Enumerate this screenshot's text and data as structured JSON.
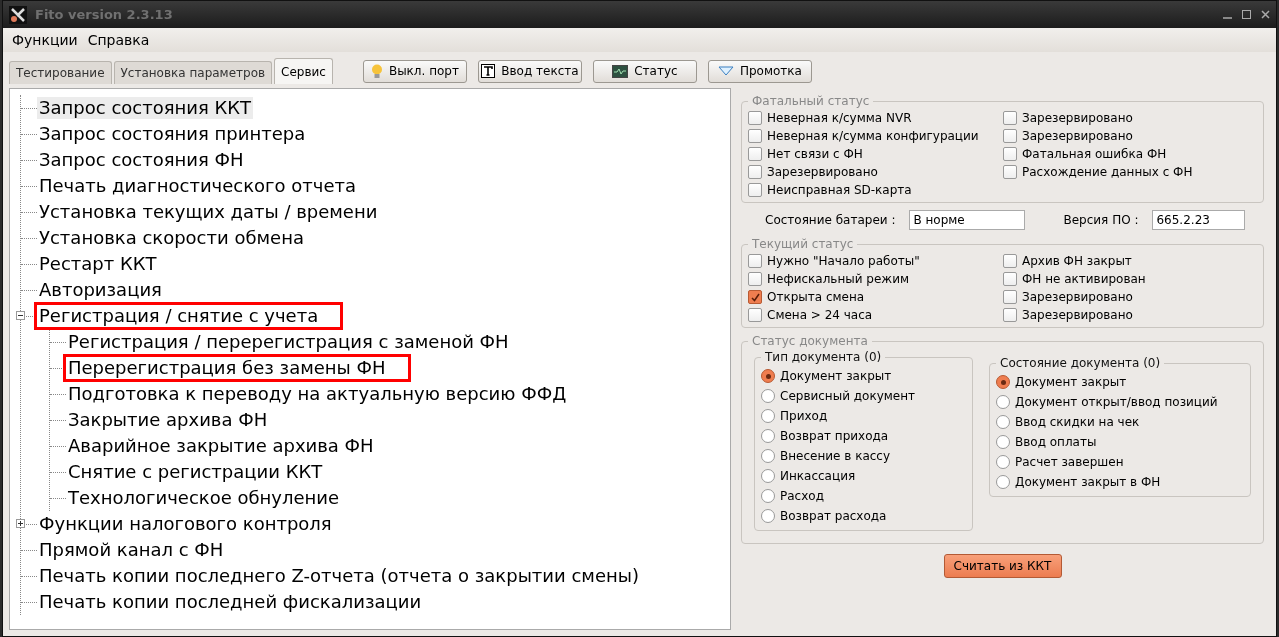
{
  "window": {
    "title": "Fito version 2.3.13"
  },
  "menu": [
    "Функции",
    "Справка"
  ],
  "tabs": [
    {
      "label": "Тестирование",
      "selected": false
    },
    {
      "label": "Установка параметров",
      "selected": false
    },
    {
      "label": "Сервис",
      "selected": true
    }
  ],
  "toolbar": [
    {
      "label": "Выкл. порт",
      "kind": "bulb"
    },
    {
      "label": "Ввод текста",
      "kind": "text"
    },
    {
      "label": "Статус",
      "kind": "monitor"
    },
    {
      "label": "Промотка",
      "kind": "triangle"
    }
  ],
  "tree": [
    {
      "label": "Запрос состояния ККТ",
      "selected": true,
      "highlighted": false
    },
    {
      "label": "Запрос состояния принтера",
      "selected": false,
      "highlighted": false
    },
    {
      "label": "Запрос состояния ФН",
      "selected": false,
      "highlighted": false
    },
    {
      "label": "Печать диагностического отчета",
      "selected": false,
      "highlighted": false
    },
    {
      "label": "Установка текущих даты / времени",
      "selected": false,
      "highlighted": false
    },
    {
      "label": "Установка скорости обмена",
      "selected": false,
      "highlighted": false
    },
    {
      "label": "Рестарт ККТ",
      "selected": false,
      "highlighted": false
    },
    {
      "label": "Авторизация",
      "selected": false,
      "highlighted": false
    },
    {
      "label": "Регистрация / снятие с учета",
      "selected": false,
      "highlighted": true,
      "expanded": true,
      "children": [
        {
          "label": "Регистрация / перерегистрация с заменой ФН",
          "selected": false,
          "highlighted": false
        },
        {
          "label": "Перерегистрация без замены ФН",
          "selected": false,
          "highlighted": true
        },
        {
          "label": "Подготовка к переводу на актуальную версию ФФД",
          "selected": false,
          "highlighted": false
        },
        {
          "label": "Закрытие архива ФН",
          "selected": false,
          "highlighted": false
        },
        {
          "label": "Аварийное закрытие архива ФН",
          "selected": false,
          "highlighted": false
        },
        {
          "label": "Снятие с регистрации ККТ",
          "selected": false,
          "highlighted": false
        },
        {
          "label": "Технологическое обнуление",
          "selected": false,
          "highlighted": false
        }
      ]
    },
    {
      "label": "Функции налогового контроля",
      "selected": false,
      "highlighted": false,
      "expanded": false
    },
    {
      "label": "Прямой канал с ФН",
      "selected": false,
      "highlighted": false
    },
    {
      "label": "Печать копии последнего Z-отчета (отчета о закрытии смены)",
      "selected": false,
      "highlighted": false
    },
    {
      "label": "Печать копии последней фискализации",
      "selected": false,
      "highlighted": false
    }
  ],
  "fatal_status": {
    "title": "Фатальный статус",
    "items": [
      {
        "label": "Неверная к/сумма NVR",
        "checked": false
      },
      {
        "label": "Зарезервировано",
        "checked": false
      },
      {
        "label": "Неверная к/сумма конфигурации",
        "checked": false
      },
      {
        "label": "Зарезервировано",
        "checked": false
      },
      {
        "label": "Нет связи с ФН",
        "checked": false
      },
      {
        "label": "Фатальная ошибка ФН",
        "checked": false
      },
      {
        "label": "Зарезервировано",
        "checked": false
      },
      {
        "label": "Расхождение данных с ФН",
        "checked": false
      },
      {
        "label": "Неисправная SD-карта",
        "checked": false
      }
    ]
  },
  "battery": {
    "label": "Состояние батареи :",
    "value": "В норме"
  },
  "firmware": {
    "label": "Версия ПО :",
    "value": "665.2.23"
  },
  "current_status": {
    "title": "Текущий статус",
    "items": [
      {
        "label": "Нужно \"Начало работы\"",
        "checked": false
      },
      {
        "label": "Архив ФН закрыт",
        "checked": false
      },
      {
        "label": "Нефискальный режим",
        "checked": false
      },
      {
        "label": "ФН не активирован",
        "checked": false
      },
      {
        "label": "Открыта смена",
        "checked": true
      },
      {
        "label": "Зарезервировано",
        "checked": false
      },
      {
        "label": "Смена > 24 часа",
        "checked": false
      },
      {
        "label": "Зарезервировано",
        "checked": false
      }
    ]
  },
  "document_status": {
    "title": "Статус документа",
    "doc_type": {
      "title": "Тип документа (0)",
      "options": [
        {
          "label": "Документ закрыт",
          "selected": true
        },
        {
          "label": "Сервисный документ",
          "selected": false
        },
        {
          "label": "Приход",
          "selected": false
        },
        {
          "label": "Возврат прихода",
          "selected": false
        },
        {
          "label": "Внесение в кассу",
          "selected": false
        },
        {
          "label": "Инкассация",
          "selected": false
        },
        {
          "label": "Расход",
          "selected": false
        },
        {
          "label": "Возврат расхода",
          "selected": false
        }
      ]
    },
    "doc_state": {
      "title": "Состояние документа (0)",
      "options": [
        {
          "label": "Документ закрыт",
          "selected": true
        },
        {
          "label": "Документ открыт/ввод позиций",
          "selected": false
        },
        {
          "label": "Ввод скидки на чек",
          "selected": false
        },
        {
          "label": "Ввод оплаты",
          "selected": false
        },
        {
          "label": "Расчет завершен",
          "selected": false
        },
        {
          "label": "Документ закрыт в ФН",
          "selected": false
        }
      ]
    }
  },
  "read_button": "Считать из ККТ"
}
